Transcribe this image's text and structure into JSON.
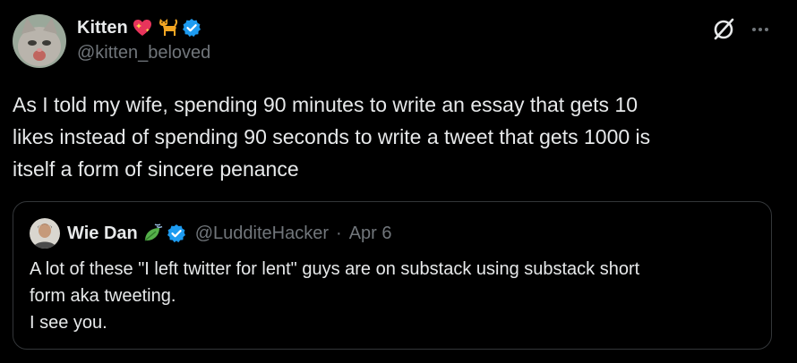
{
  "tweet": {
    "author": {
      "display_name": "Kitten",
      "handle": "@kitten_beloved",
      "emojis": [
        "sparkling-heart",
        "cat"
      ],
      "verified": true
    },
    "text": "As I told my wife, spending 90 minutes to write an essay that gets 10\nlikes instead of spending 90 seconds to write a tweet that gets 1000 is\nitself a form of sincere penance",
    "actions": {
      "grok_icon": "grok-icon",
      "more_icon": "more-icon"
    }
  },
  "quote": {
    "author": {
      "display_name": "Wie Dan",
      "emoji": "leaf-fluttering-in-wind",
      "verified": true,
      "handle": "@LudditeHacker",
      "separator": "·",
      "date": "Apr 6"
    },
    "text": "A lot of these \"I left twitter for lent\" guys are on substack using substack short\nform aka tweeting.\nI see you."
  },
  "colors": {
    "background": "#000000",
    "text_primary": "#e7e9ea",
    "text_secondary": "#71767b",
    "verified_blue": "#1d9bf0",
    "border": "#333639"
  }
}
